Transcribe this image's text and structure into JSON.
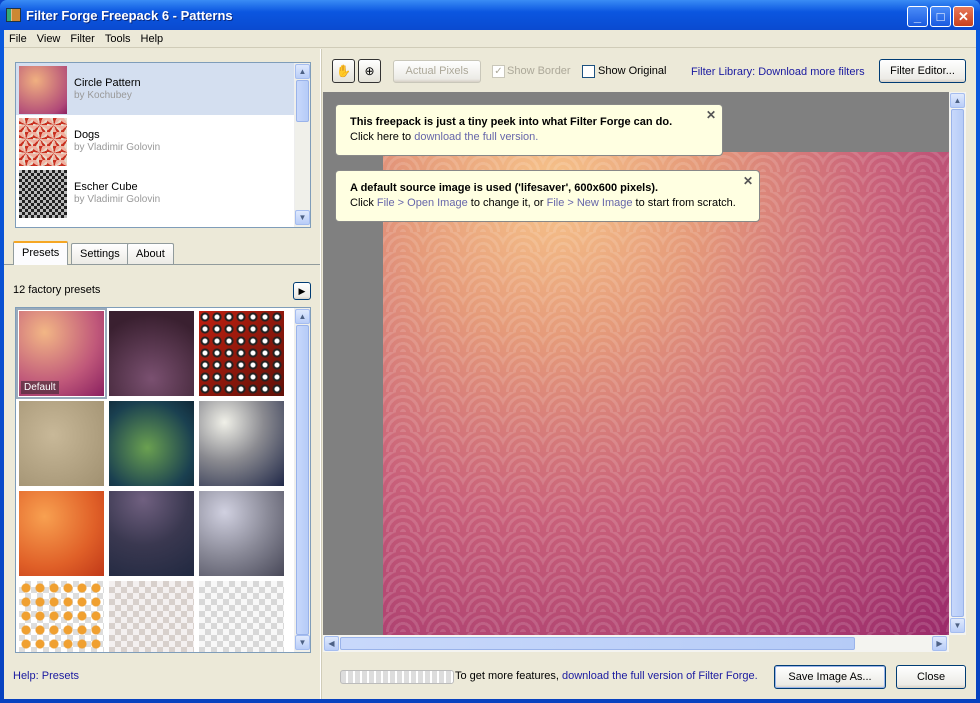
{
  "window": {
    "title": "Filter Forge Freepack 6 - Patterns",
    "controls": [
      "_",
      "□",
      "✕"
    ]
  },
  "menu": [
    "File",
    "View",
    "Filter",
    "Tools",
    "Help"
  ],
  "filters": [
    {
      "name": "Circle Pattern",
      "author": "by  Kochubey",
      "selected": true,
      "thumb": "radial-gradient(circle at 35% 30%,#f0b080,#b04878 80%,#8a2060)"
    },
    {
      "name": "Dogs",
      "author": "by  Vladimir Golovin",
      "thumb": "repeating-conic-gradient(#c83020 0 20deg,#f0b0a0 20deg 50deg,#e8d8c8 50deg 70deg) 0 0/14px 14px"
    },
    {
      "name": "Escher Cube",
      "author": "by  Vladimir Golovin",
      "thumb": "repeating-conic-gradient(#222 0 25%,#bbb 0 50%) 0 0/6px 6px"
    }
  ],
  "tabs": [
    "Presets",
    "Settings",
    "About"
  ],
  "presets": {
    "count_label": "12 factory presets",
    "default_label": "Default",
    "thumbs": [
      "radial-gradient(circle at 30% 25%,#f2b685,#c0587a 60%,#8a2060)",
      "radial-gradient(circle at 50% 80%,#7a5070,#3a2030 80%)",
      "radial-gradient(circle,#fff 0 2px,#222 3px 4px,transparent 5px) 0 0/12px 12px,linear-gradient(135deg,#c02010,#601008)",
      "radial-gradient(circle at 40% 40%,#c8b898,#a09070)",
      "radial-gradient(circle at 45% 55%,#6aa050,#1a4050 70%,#102838)",
      "radial-gradient(circle at 30% 25%,#f0f0e8,#8a8a90 45%,#202848)",
      "radial-gradient(circle at 30% 30%,#f8a050,#e06028 60%,#c03818)",
      "radial-gradient(circle at 40% 10%,#706080,#3a3850 50%,#202840)",
      "radial-gradient(circle at 30% 25%,#d0d0e0,#8a8a98 50%,#484858)",
      "radial-gradient(circle,#f0a030 0 4px,transparent 5px) 0 0/14px 14px,repeating-conic-gradient(#ddd 0 25%,#fff 0 50%) 0 0/12px 12px",
      "repeating-conic-gradient(#d8d0cc 0 25%,#f4f0f0 0 50%) 0 0/12px 12px",
      "repeating-conic-gradient(#d8d8d8 0 25%,#f8f8f8 0 50%) 0 0/12px 12px"
    ]
  },
  "help_link": "Help: Presets",
  "toolbar": {
    "hand_icon": "✋",
    "zoom_icon": "⊕",
    "actual_pixels": "Actual Pixels",
    "show_border": "Show Border",
    "show_border_checked": true,
    "show_original": "Show Original",
    "show_original_checked": false,
    "library_link": "Filter Library: Download more filters",
    "filter_editor": "Filter Editor..."
  },
  "tips": [
    {
      "bold": "This freepack is just a tiny peek into what Filter Forge can do.",
      "pre": "Click here to ",
      "link": "download the full version."
    },
    {
      "bold": "A default source image is used ('lifesaver', 600x600 pixels).",
      "pre": "Click ",
      "link1": "File > Open Image",
      "mid": " to change it, or ",
      "link2": "File > New Image",
      "post": " to start from scratch."
    }
  ],
  "bottom": {
    "pre": "To get more features, ",
    "link": "download the full version of Filter Forge.",
    "save": "Save Image As...",
    "close": "Close"
  }
}
